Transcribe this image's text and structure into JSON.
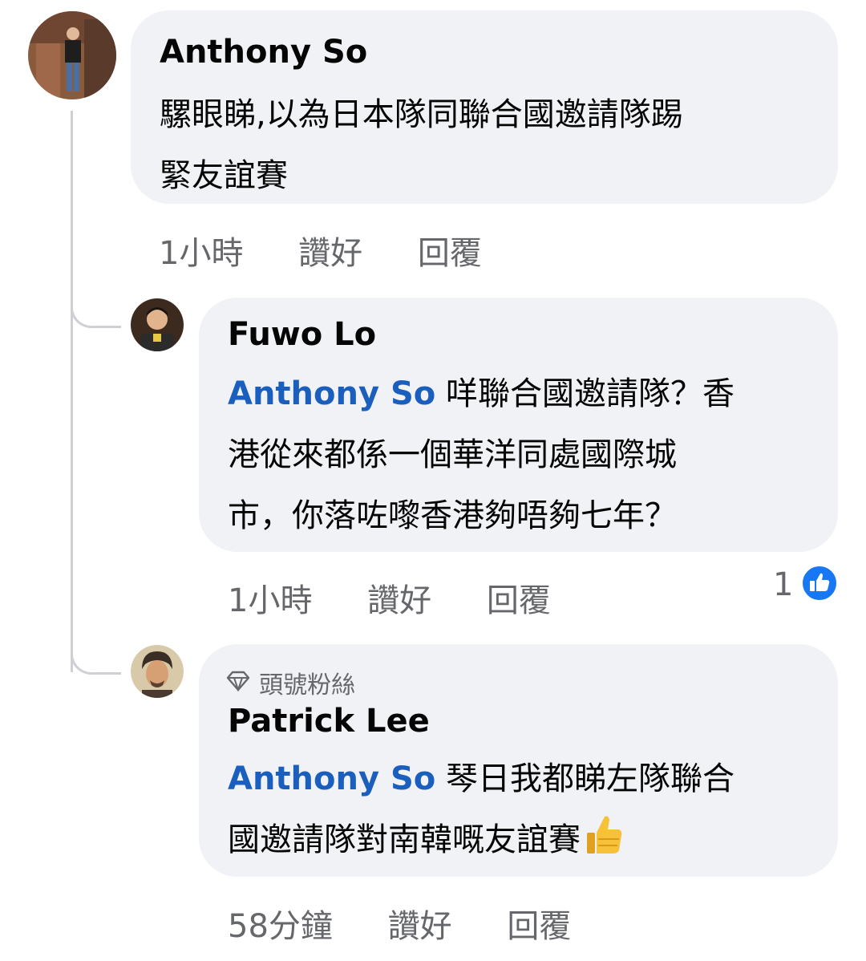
{
  "comments": [
    {
      "author": "Anthony So",
      "text": "騾眼睇,以為日本隊同聯合國邀請隊踢緊友誼賽",
      "text_lines": [
        "騾眼睇,以為日本隊同聯合國邀請隊踢",
        "緊友誼賽"
      ],
      "time": "1小時",
      "like_label": "讚好",
      "reply_label": "回覆"
    },
    {
      "author": "Fuwo Lo",
      "mention": "Anthony So",
      "text_lines": [
        " 咩聯合國邀請隊？香",
        "港從來都係一個華洋同處國際城",
        "市，你落咗嚟香港夠唔夠七年？"
      ],
      "time": "1小時",
      "like_label": "讚好",
      "reply_label": "回覆",
      "reaction_count": "1",
      "reaction_icon": "like-thumb-icon",
      "reaction_color": "#1877f2"
    },
    {
      "badge": "頭號粉絲",
      "badge_icon": "diamond-icon",
      "author": "Patrick Lee",
      "mention": "Anthony So",
      "text_lines": [
        " 琴日我都睇左隊聯合",
        "國邀請隊對南韓嘅友誼賽"
      ],
      "emoji_icon": "thumbs-up-emoji-icon",
      "time": "58分鐘",
      "like_label": "讚好",
      "reply_label": "回覆"
    }
  ],
  "colors": {
    "bubble": "#f0f2f5",
    "mention": "#1b5fbe",
    "meta_text": "#65676b",
    "thread_line": "#ced0d4"
  }
}
